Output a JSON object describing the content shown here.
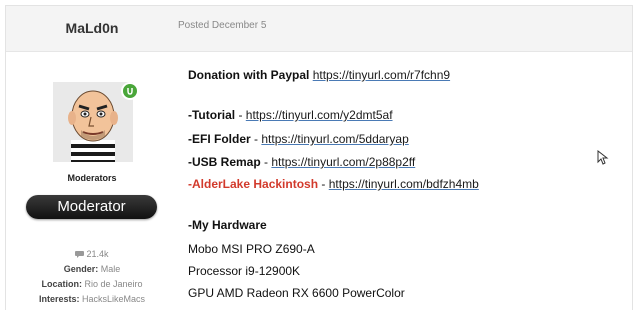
{
  "author": {
    "name": "MaLd0n",
    "group": "Moderators",
    "badge": "Moderator",
    "posts_count": "21.4k",
    "gender_label": "Gender:",
    "gender_value": "Male",
    "location_label": "Location:",
    "location_value": "Rio de Janeiro",
    "interests_label": "Interests:",
    "interests_value": "HacksLikeMacs"
  },
  "post": {
    "posted": "Posted December 5",
    "donation_label": "Donation with Paypal",
    "donation_link": "https://tinyurl.com/r7fchn9",
    "tutorial_label": "-Tutorial",
    "tutorial_link": "https://tinyurl.com/y2dmt5af",
    "efi_label": "-EFI Folder",
    "efi_link": "https://tinyurl.com/5ddaryap",
    "usb_label": "-USB Remap",
    "usb_link": "https://tinyurl.com/2p88p2ff",
    "alder_label": "-AlderLake Hackintosh",
    "alder_link": "https://tinyurl.com/bdfzh4mb",
    "dash": "-",
    "hardware_label": "-My Hardware",
    "hw1": "Mobo MSI PRO Z690-A",
    "hw2": "Processor i9-12900K",
    "hw3": "GPU AMD Radeon RX 6600 PowerColor"
  },
  "colors": {
    "accent_red": "#d23a2c",
    "online_green": "#4aa63a",
    "link_underline": "#4a7ab5"
  },
  "icons": [
    "chat-bubble-icon",
    "online-badge-icon",
    "mouse-cursor-icon"
  ]
}
